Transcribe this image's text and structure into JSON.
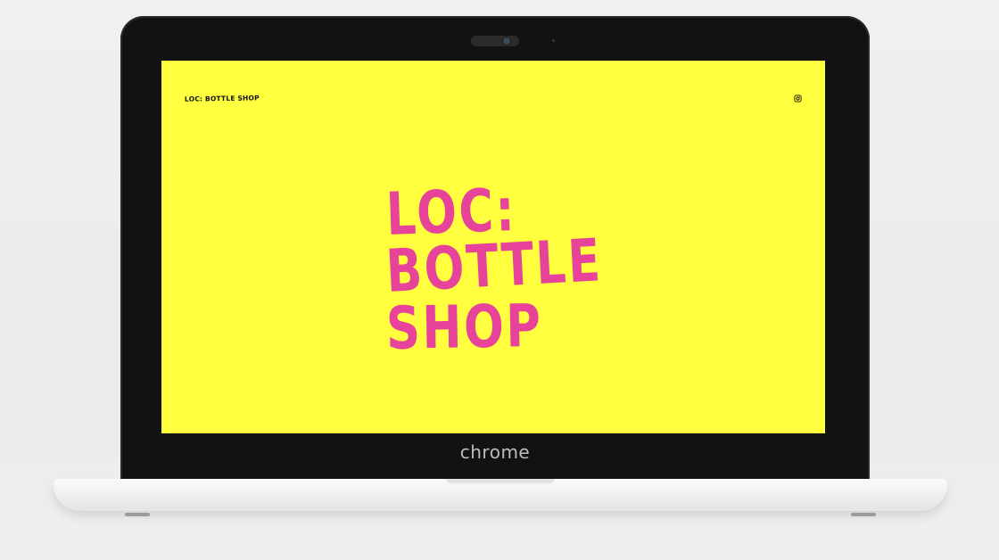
{
  "device": {
    "bezel_label": "chrome"
  },
  "website": {
    "brand": "LOC: BOTTLE SHOP",
    "hero_lines": [
      "LOC:",
      "BOTTLE",
      "SHOP"
    ],
    "social_icon": "instagram-icon",
    "colors": {
      "background": "#ffff3f",
      "hero_text": "#e8439b",
      "brand_text": "#111111"
    }
  }
}
